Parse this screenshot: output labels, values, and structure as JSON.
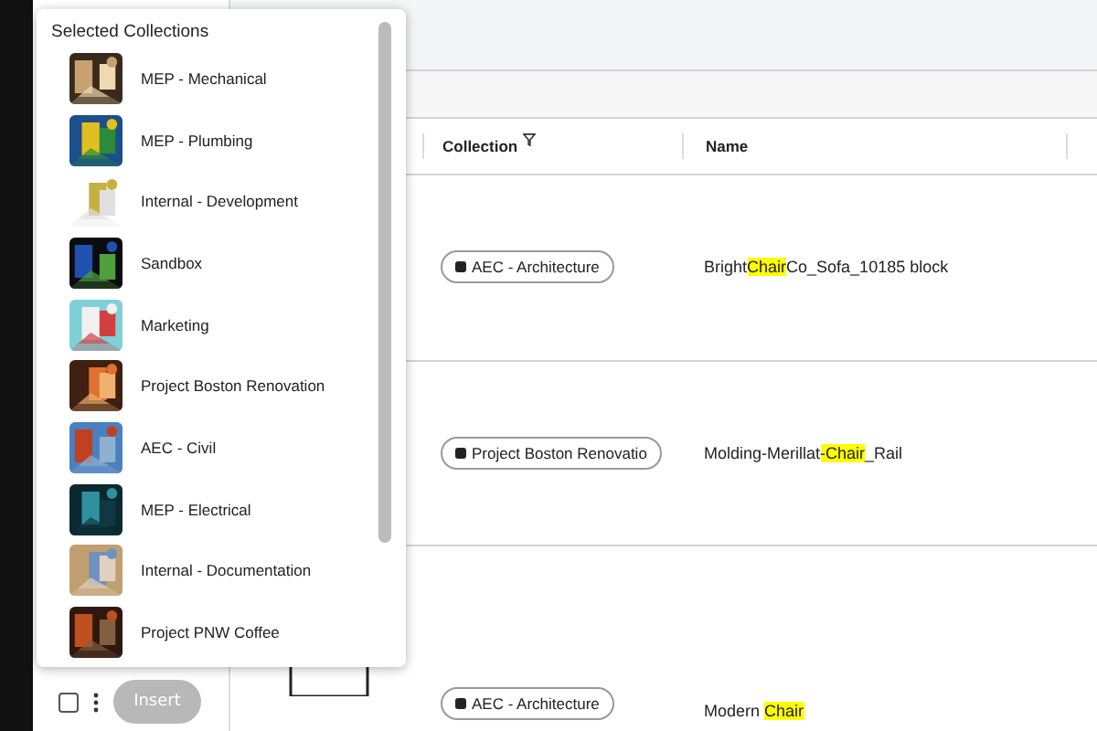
{
  "collection_menu": {
    "title": "Selected Collections",
    "items": [
      {
        "label": "MEP - Mechanical"
      },
      {
        "label": "MEP - Plumbing"
      },
      {
        "label": "Internal - Development"
      },
      {
        "label": "Sandbox"
      },
      {
        "label": "Marketing"
      },
      {
        "label": "Project Boston Renovation"
      },
      {
        "label": "AEC - Civil"
      },
      {
        "label": "MEP - Electrical"
      },
      {
        "label": "Internal - Documentation"
      },
      {
        "label": "Project PNW Coffee"
      }
    ]
  },
  "table": {
    "columns": [
      "Collection",
      "Name"
    ],
    "rows": [
      {
        "collection": "AEC - Architecture",
        "name": [
          {
            "text": "Bright",
            "match": false
          },
          {
            "text": "Chair",
            "match": true
          },
          {
            "text": "Co_Sofa_10185 block",
            "match": false
          }
        ]
      },
      {
        "collection": "Project Boston Renovatio",
        "name": [
          {
            "text": "Molding-Merillat",
            "match": false
          },
          {
            "text": "-Chair",
            "match": true
          },
          {
            "text": "_Rail",
            "match": false
          }
        ]
      },
      {
        "collection": "AEC - Architecture",
        "name": [
          {
            "text": "Modern ",
            "match": false
          },
          {
            "text": "Chair",
            "match": true
          }
        ]
      }
    ]
  },
  "toolbar": {
    "select_all": {
      "checked": false
    },
    "insert_button": {
      "label": "Insert",
      "disabled": true
    }
  }
}
